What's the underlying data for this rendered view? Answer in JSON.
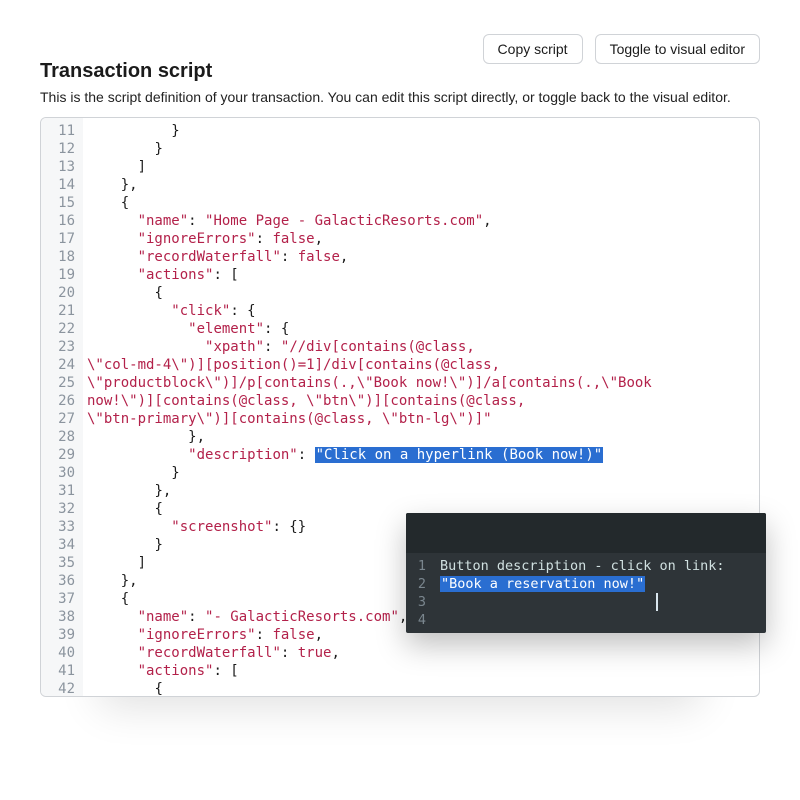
{
  "header": {
    "title": "Transaction script",
    "subtitle": "This is the script definition of your transaction. You can edit this script directly, or toggle back to the visual editor.",
    "copy_label": "Copy script",
    "toggle_label": "Toggle to visual editor"
  },
  "editor": {
    "first_line_number": 11,
    "lines": [
      {
        "indent": 10,
        "tokens": [
          {
            "cls": "p",
            "t": "}"
          }
        ]
      },
      {
        "indent": 8,
        "tokens": [
          {
            "cls": "p",
            "t": "}"
          }
        ]
      },
      {
        "indent": 6,
        "tokens": [
          {
            "cls": "p",
            "t": "]"
          }
        ]
      },
      {
        "indent": 4,
        "tokens": [
          {
            "cls": "p",
            "t": "},"
          }
        ]
      },
      {
        "indent": 4,
        "tokens": [
          {
            "cls": "p",
            "t": "{"
          }
        ]
      },
      {
        "indent": 6,
        "tokens": [
          {
            "cls": "k",
            "t": "\"name\""
          },
          {
            "cls": "p",
            "t": ": "
          },
          {
            "cls": "s",
            "t": "\"Home Page - GalacticResorts.com\""
          },
          {
            "cls": "p",
            "t": ","
          }
        ]
      },
      {
        "indent": 6,
        "tokens": [
          {
            "cls": "k",
            "t": "\"ignoreErrors\""
          },
          {
            "cls": "p",
            "t": ": "
          },
          {
            "cls": "b",
            "t": "false"
          },
          {
            "cls": "p",
            "t": ","
          }
        ]
      },
      {
        "indent": 6,
        "tokens": [
          {
            "cls": "k",
            "t": "\"recordWaterfall\""
          },
          {
            "cls": "p",
            "t": ": "
          },
          {
            "cls": "b",
            "t": "false"
          },
          {
            "cls": "p",
            "t": ","
          }
        ]
      },
      {
        "indent": 6,
        "tokens": [
          {
            "cls": "k",
            "t": "\"actions\""
          },
          {
            "cls": "p",
            "t": ": ["
          }
        ]
      },
      {
        "indent": 8,
        "tokens": [
          {
            "cls": "p",
            "t": "{"
          }
        ]
      },
      {
        "indent": 10,
        "tokens": [
          {
            "cls": "k",
            "t": "\"click\""
          },
          {
            "cls": "p",
            "t": ": {"
          }
        ]
      },
      {
        "indent": 12,
        "tokens": [
          {
            "cls": "k",
            "t": "\"element\""
          },
          {
            "cls": "p",
            "t": ": {"
          }
        ]
      },
      {
        "indent": 14,
        "tokens": [
          {
            "cls": "k",
            "t": "\"xpath\""
          },
          {
            "cls": "p",
            "t": ": "
          },
          {
            "cls": "s",
            "t": "\"//div[contains(@class, "
          }
        ]
      },
      {
        "indent": 0,
        "tokens": [
          {
            "cls": "s",
            "t": "\\\"col-md-4\\\")][position()=1]/div[contains(@class, "
          }
        ]
      },
      {
        "indent": 0,
        "tokens": [
          {
            "cls": "s",
            "t": "\\\"productblock\\\")]/p[contains(.,\\\"Book now!\\\")]/a[contains(.,\\\"Book "
          }
        ]
      },
      {
        "indent": 0,
        "tokens": [
          {
            "cls": "s",
            "t": "now!\\\")][contains(@class, \\\"btn\\\")][contains(@class, "
          }
        ]
      },
      {
        "indent": 0,
        "tokens": [
          {
            "cls": "s",
            "t": "\\\"btn-primary\\\")][contains(@class, \\\"btn-lg\\\")]\""
          }
        ]
      },
      {
        "indent": 12,
        "tokens": [
          {
            "cls": "p",
            "t": "},"
          }
        ]
      },
      {
        "indent": 12,
        "tokens": [
          {
            "cls": "k",
            "t": "\"description\""
          },
          {
            "cls": "p",
            "t": ": "
          },
          {
            "cls": "s hl",
            "t": "\"Click on a hyperlink (Book now!)\""
          }
        ]
      },
      {
        "indent": 10,
        "tokens": [
          {
            "cls": "p",
            "t": "}"
          }
        ]
      },
      {
        "indent": 8,
        "tokens": [
          {
            "cls": "p",
            "t": "},"
          }
        ]
      },
      {
        "indent": 8,
        "tokens": [
          {
            "cls": "p",
            "t": "{"
          }
        ]
      },
      {
        "indent": 10,
        "tokens": [
          {
            "cls": "k",
            "t": "\"screenshot\""
          },
          {
            "cls": "p",
            "t": ": {}"
          }
        ]
      },
      {
        "indent": 8,
        "tokens": [
          {
            "cls": "p",
            "t": "}"
          }
        ]
      },
      {
        "indent": 6,
        "tokens": [
          {
            "cls": "p",
            "t": "]"
          }
        ]
      },
      {
        "indent": 4,
        "tokens": [
          {
            "cls": "p",
            "t": "},"
          }
        ]
      },
      {
        "indent": 4,
        "tokens": [
          {
            "cls": "p",
            "t": "{"
          }
        ]
      },
      {
        "indent": 6,
        "tokens": [
          {
            "cls": "k",
            "t": "\"name\""
          },
          {
            "cls": "p",
            "t": ": "
          },
          {
            "cls": "s",
            "t": "\"- GalacticResorts.com\""
          },
          {
            "cls": "p",
            "t": ","
          }
        ]
      },
      {
        "indent": 6,
        "tokens": [
          {
            "cls": "k",
            "t": "\"ignoreErrors\""
          },
          {
            "cls": "p",
            "t": ": "
          },
          {
            "cls": "b",
            "t": "false"
          },
          {
            "cls": "p",
            "t": ","
          }
        ]
      },
      {
        "indent": 6,
        "tokens": [
          {
            "cls": "k",
            "t": "\"recordWaterfall\""
          },
          {
            "cls": "p",
            "t": ": "
          },
          {
            "cls": "b",
            "t": "true"
          },
          {
            "cls": "p",
            "t": ","
          }
        ]
      },
      {
        "indent": 6,
        "tokens": [
          {
            "cls": "k",
            "t": "\"actions\""
          },
          {
            "cls": "p",
            "t": ": ["
          }
        ]
      },
      {
        "indent": 8,
        "tokens": [
          {
            "cls": "p",
            "t": "{"
          }
        ]
      }
    ]
  },
  "overlay": {
    "line1": "Button description - click on link:",
    "line2_highlighted": "\"Book a reservation now!\"",
    "line_numbers": [
      "1",
      "2",
      "3",
      "4"
    ]
  }
}
